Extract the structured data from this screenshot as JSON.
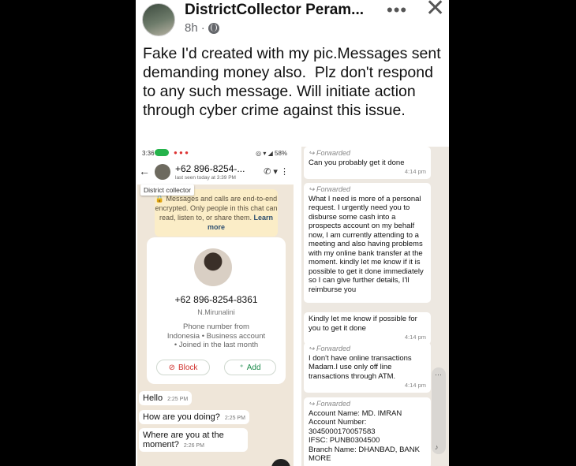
{
  "post": {
    "author": "DistrictCollector Peram...",
    "time": "8h",
    "dot": "·",
    "more_icon": "•••",
    "close_icon": "✕",
    "text": "Fake I'd created with my pic.Messages sent demanding money also.  Plz don't respond to any such message. Will initiate action through cyber crime against this issue."
  },
  "left_shot": {
    "status_time": "3:36",
    "status_right": "◎ ▾ ◢ 58%",
    "contact_number": "+62 896-8254-...",
    "last_seen": "last seen today at 3:39 PM",
    "tooltip": "District collector",
    "encryption_text": "🔒 Messages and calls are end-to-end encrypted. Only people in this chat can read, listen to, or share them.",
    "encryption_link": "Learn more",
    "profile": {
      "number": "+62 896-8254-8361",
      "name": "N.Mirunalini",
      "info": "Phone number from\nIndonesia • Business account\n• Joined in the last month",
      "block_label": "Block",
      "add_label": "Add"
    },
    "messages": [
      {
        "text": "Hello",
        "time": "2:25 PM"
      },
      {
        "text": "How are you doing?",
        "time": "2:25 PM"
      },
      {
        "text": "Where are you at the moment?",
        "time": "2:26 PM"
      }
    ]
  },
  "right_shot": {
    "forwarded_label": "Forwarded",
    "messages": [
      {
        "forwarded": true,
        "text": "Can you probably get it done",
        "time": "4:14 pm"
      },
      {
        "forwarded": true,
        "text": "What I need is more of a personal request. I urgently need you to disburse some cash into a prospects  account on my behalf now, I am currently attending to a meeting and also having problems with my online bank transfer at the moment. kindly let me know if it is possible to get it done immediately so I can give further details, I'll reimburse you",
        "time": ""
      },
      {
        "forwarded": false,
        "text": "Kindly let me know if possible for you to get it done",
        "time": "4:14 pm"
      },
      {
        "forwarded": true,
        "text": "I don't have online transactions Madam.I use only off line transactions through ATM.",
        "time": "4:14 pm"
      },
      {
        "forwarded": true,
        "text": "Account Name: MD. IMRAN\nAccount Number: 3045000170057583\nIFSC: PUNB0304500\nBranch Name: DHANBAD, BANK MORE",
        "time": ""
      }
    ]
  }
}
